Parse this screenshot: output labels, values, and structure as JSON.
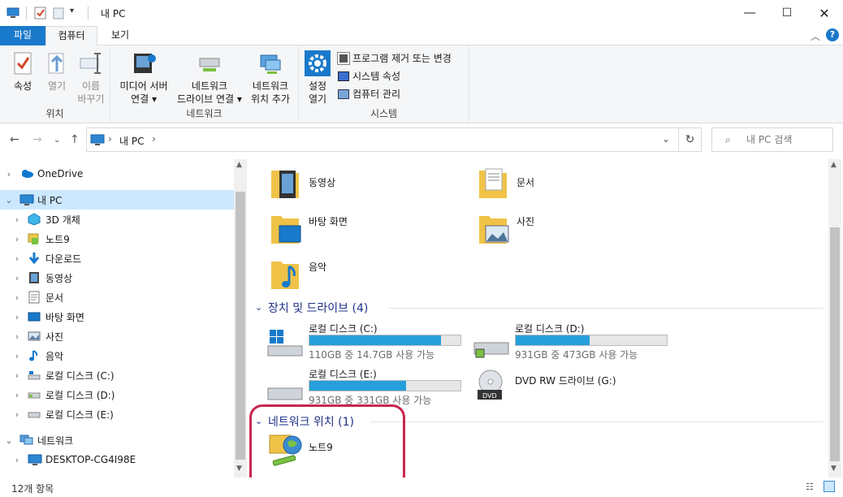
{
  "window": {
    "title": "내 PC"
  },
  "ribbon_tabs": [
    "파일",
    "컴퓨터",
    "보기"
  ],
  "ribbon": {
    "location": {
      "label": "위치",
      "properties": "속성",
      "open": "열기",
      "rename_1": "이름",
      "rename_2": "바꾸기"
    },
    "network": {
      "label": "네트워크",
      "media_1": "미디어 서버",
      "media_2": "연결",
      "map_1": "네트워크",
      "map_2": "드라이브 연결",
      "add_1": "네트워크",
      "add_2": "위치 추가"
    },
    "system": {
      "label": "시스템",
      "settings_1": "설정",
      "settings_2": "열기",
      "uninstall": "프로그램 제거 또는 변경",
      "sys_props": "시스템 속성",
      "manage": "컴퓨터 관리"
    }
  },
  "address": {
    "path_label": "내 PC",
    "search_placeholder": "내 PC 검색"
  },
  "nav": [
    {
      "label": "OneDrive",
      "icon": "cloud-icon"
    },
    {
      "label": "내 PC",
      "icon": "computer-icon"
    },
    {
      "label": "3D 개체",
      "icon": "cube-icon"
    },
    {
      "label": "노트9",
      "icon": "phone-icon"
    },
    {
      "label": "다운로드",
      "icon": "download-icon"
    },
    {
      "label": "동영상",
      "icon": "video-icon"
    },
    {
      "label": "문서",
      "icon": "document-icon"
    },
    {
      "label": "바탕 화면",
      "icon": "desktop-icon"
    },
    {
      "label": "사진",
      "icon": "picture-icon"
    },
    {
      "label": "음악",
      "icon": "music-icon"
    },
    {
      "label": "로컬 디스크 (C:)",
      "icon": "drive-icon"
    },
    {
      "label": "로컬 디스크 (D:)",
      "icon": "drive-icon"
    },
    {
      "label": "로컬 디스크 (E:)",
      "icon": "drive-icon"
    },
    {
      "label": "네트워크",
      "icon": "network-icon"
    },
    {
      "label": "DESKTOP-CG4I98E",
      "icon": "computer-icon"
    }
  ],
  "folders": [
    {
      "label": "동영상",
      "icon": "video-folder-icon"
    },
    {
      "label": "문서",
      "icon": "document-folder-icon"
    },
    {
      "label": "바탕 화면",
      "icon": "desktop-folder-icon"
    },
    {
      "label": "사진",
      "icon": "picture-folder-icon"
    },
    {
      "label": "음악",
      "icon": "music-folder-icon"
    }
  ],
  "devices": {
    "header": "장치 및 드라이브 (4)",
    "items": [
      {
        "label": "로컬 디스크 (C:)",
        "free": "110GB 중 14.7GB 사용 가능",
        "used_fraction": 0.87
      },
      {
        "label": "로컬 디스크 (D:)",
        "free": "931GB 중 473GB 사용 가능",
        "used_fraction": 0.49
      },
      {
        "label": "로컬 디스크 (E:)",
        "free": "931GB 중 331GB 사용 가능",
        "used_fraction": 0.64
      },
      {
        "label": "DVD RW 드라이브 (G:)"
      }
    ]
  },
  "network_locations": {
    "header": "네트워크 위치 (1)",
    "items": [
      {
        "label": "노트9"
      }
    ]
  },
  "status": {
    "count": "12개 항목"
  },
  "colors": {
    "accent": "#1979ca",
    "bar_fill": "#26a0da",
    "highlight": "#c8284e",
    "selected": "#cce8ff"
  }
}
